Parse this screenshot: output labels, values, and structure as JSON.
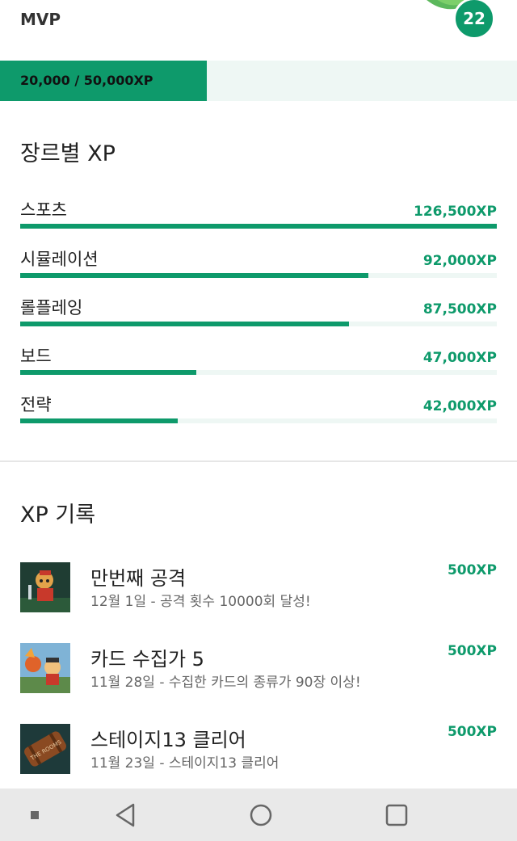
{
  "profile": {
    "rank": "MVP",
    "level": "22",
    "xp_text": "20,000 / 50,000XP",
    "xp_progress": 0.4
  },
  "genres_section": {
    "title": "장르별 XP",
    "items": [
      {
        "name": "스포츠",
        "xp": "126,500XP",
        "fraction": 1.0
      },
      {
        "name": "시뮬레이션",
        "xp": "92,000XP",
        "fraction": 0.73
      },
      {
        "name": "롤플레잉",
        "xp": "87,500XP",
        "fraction": 0.69
      },
      {
        "name": "보드",
        "xp": "47,000XP",
        "fraction": 0.37
      },
      {
        "name": "전략",
        "xp": "42,000XP",
        "fraction": 0.33
      }
    ]
  },
  "records_section": {
    "title": "XP 기록",
    "items": [
      {
        "title": "만번째 공격",
        "desc": "12월 1일 - 공격 횟수 10000회 달성!",
        "xp": "500XP",
        "icon": "warrior-game-icon"
      },
      {
        "title": "카드 수집가 5",
        "desc": "11월 28일 - 수집한 카드의 종류가 90장 이상!",
        "xp": "500XP",
        "icon": "dragon-game-icon"
      },
      {
        "title": "스테이지13 클리어",
        "desc": "11월 23일 - 스테이지13 클리어",
        "xp": "500XP",
        "icon": "barrel-game-icon",
        "thumb_text": "THE ROOMS"
      }
    ]
  },
  "navbar": {
    "buttons": [
      "dot-icon",
      "back-icon",
      "home-icon",
      "recents-icon"
    ]
  },
  "colors": {
    "accent": "#0e9a6b",
    "track": "#eef7f4",
    "navbar": "#e9e9e9"
  }
}
